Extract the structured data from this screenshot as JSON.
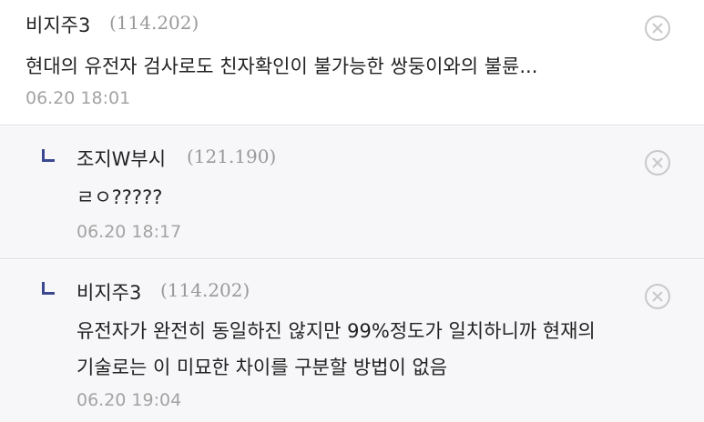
{
  "comments": [
    {
      "author": "비지주3",
      "ip": "(114.202)",
      "lines": [
        "현대의 유전자 검사로도 친자확인이 불가능한 쌍둥이와의 불륜..."
      ],
      "date": "06.20 18:01",
      "is_reply": false
    },
    {
      "author": "조지W부시",
      "ip": "(121.190)",
      "lines": [
        "ㄹㅇ?????"
      ],
      "date": "06.20 18:17",
      "is_reply": true
    },
    {
      "author": "비지주3",
      "ip": "(114.202)",
      "lines": [
        "유전자가 완전히 동일하진 않지만 99%정도가 일치하니까 현재의",
        "기술로는 이 미묘한 차이를 구분할 방법이 없음"
      ],
      "date": "06.20 19:04",
      "is_reply": true
    }
  ],
  "icons": {
    "delete": "close-circle-icon"
  },
  "colors": {
    "reply_mark": "#3b4890",
    "reply_bg": "#f7f7f9",
    "meta": "#999999"
  }
}
